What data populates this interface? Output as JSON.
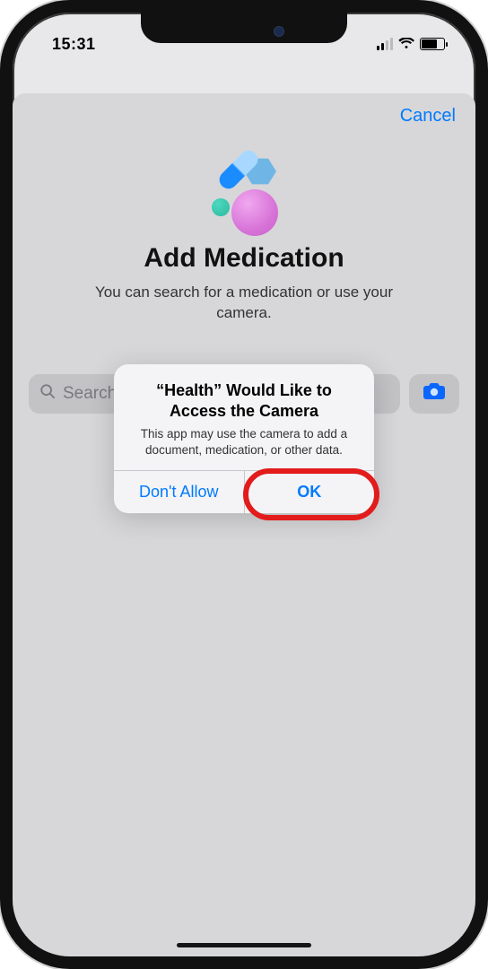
{
  "status": {
    "time": "15:31"
  },
  "sheet": {
    "cancel": "Cancel",
    "title": "Add Medication",
    "subtitle": "You can search for a medication or use your camera.",
    "search_placeholder": "Search"
  },
  "alert": {
    "title": "“Health” Would Like to Access the Camera",
    "message": "This app may use the camera to add a document, medication, or other data.",
    "deny": "Don't Allow",
    "allow": "OK"
  },
  "annotation": {
    "highlight_target": "allow"
  }
}
